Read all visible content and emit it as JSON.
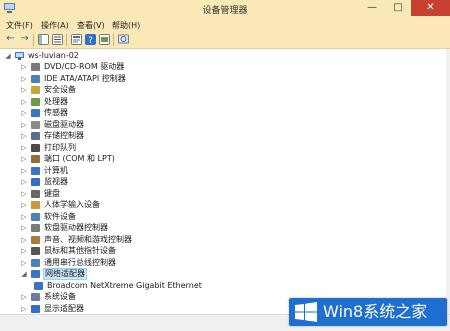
{
  "window": {
    "title": "设备管理器",
    "min": "—",
    "max": "□",
    "close": "✕"
  },
  "menu": [
    "文件(F)",
    "操作(A)",
    "查看(V)",
    "帮助(H)"
  ],
  "icons": {
    "back": "←",
    "forward": "→",
    "expanded": "◢",
    "collapsed": "▷"
  },
  "tree": {
    "root": "ws-luvian-02",
    "items": [
      {
        "label": "DVD/CD-ROM 驱动器",
        "icon": "dvd-icon"
      },
      {
        "label": "IDE ATA/ATAPI 控制器",
        "icon": "ide-controller-icon"
      },
      {
        "label": "安全设备",
        "icon": "security-device-icon"
      },
      {
        "label": "处理器",
        "icon": "processor-icon"
      },
      {
        "label": "传感器",
        "icon": "sensor-icon"
      },
      {
        "label": "磁盘驱动器",
        "icon": "disk-drive-icon"
      },
      {
        "label": "存储控制器",
        "icon": "storage-controller-icon"
      },
      {
        "label": "打印队列",
        "icon": "printer-icon"
      },
      {
        "label": "端口 (COM 和 LPT)",
        "icon": "port-icon"
      },
      {
        "label": "计算机",
        "icon": "computer-icon"
      },
      {
        "label": "监视器",
        "icon": "monitor-icon"
      },
      {
        "label": "键盘",
        "icon": "keyboard-icon"
      },
      {
        "label": "人体学输入设备",
        "icon": "hid-icon"
      },
      {
        "label": "软件设备",
        "icon": "software-device-icon"
      },
      {
        "label": "软盘驱动器控制器",
        "icon": "floppy-controller-icon"
      },
      {
        "label": "声音、视频和游戏控制器",
        "icon": "sound-icon"
      },
      {
        "label": "鼠标和其他指针设备",
        "icon": "mouse-icon"
      },
      {
        "label": "通用串行总线控制器",
        "icon": "usb-icon"
      },
      {
        "label": "网络适配器",
        "icon": "network-adapter-icon",
        "expanded": true
      },
      {
        "label": "Broadcom NetXtreme Gigabit Ethernet",
        "icon": "network-card-icon",
        "child": true
      },
      {
        "label": "系统设备",
        "icon": "system-device-icon"
      },
      {
        "label": "显示适配器",
        "icon": "display-adapter-icon"
      }
    ]
  },
  "watermark": {
    "text": "Win8系统之家"
  }
}
